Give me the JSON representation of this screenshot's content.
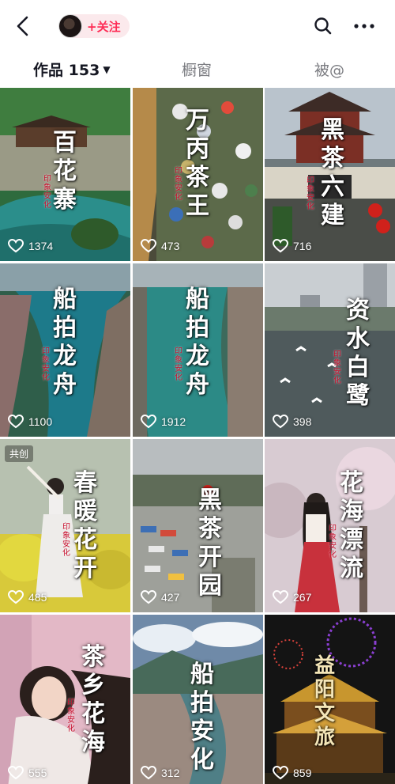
{
  "header": {
    "follow_label": "+关注",
    "icons": {
      "back": "back-arrow-icon",
      "search": "search-icon",
      "more": "more-dots-icon"
    }
  },
  "tabs": {
    "works_label": "作品",
    "works_count": "153",
    "shop_label": "橱窗",
    "mention_label": "被@"
  },
  "videos": [
    {
      "title": "百花寨",
      "seal": "印象安化",
      "likes": "1374",
      "badge": ""
    },
    {
      "title": "万丙茶王",
      "seal": "印象安化",
      "likes": "473",
      "badge": ""
    },
    {
      "title": "黑茶六建",
      "seal": "印象安化",
      "likes": "716",
      "badge": ""
    },
    {
      "title": "船拍龙舟",
      "seal": "印象安化",
      "likes": "1100",
      "badge": ""
    },
    {
      "title": "船拍龙舟",
      "seal": "印象安化",
      "likes": "1912",
      "badge": ""
    },
    {
      "title": "资水白鹭",
      "seal": "印象安化",
      "likes": "398",
      "badge": ""
    },
    {
      "title": "春暖花开",
      "seal": "印象安化",
      "likes": "485",
      "badge": "共创"
    },
    {
      "title": "黑茶开园",
      "seal": "",
      "likes": "427",
      "badge": ""
    },
    {
      "title": "花海漂流",
      "seal": "印象安化",
      "likes": "267",
      "badge": ""
    },
    {
      "title": "茶乡花海",
      "seal": "印象安化",
      "likes": "555",
      "badge": ""
    },
    {
      "title": "船拍安化",
      "seal": "",
      "likes": "312",
      "badge": ""
    },
    {
      "title": "益阳文旅",
      "seal": "",
      "likes": "859",
      "badge": ""
    }
  ],
  "colors": {
    "accent": "#fe2c55",
    "follow_bg": "#fbe9ec",
    "muted": "#7a7b80"
  }
}
